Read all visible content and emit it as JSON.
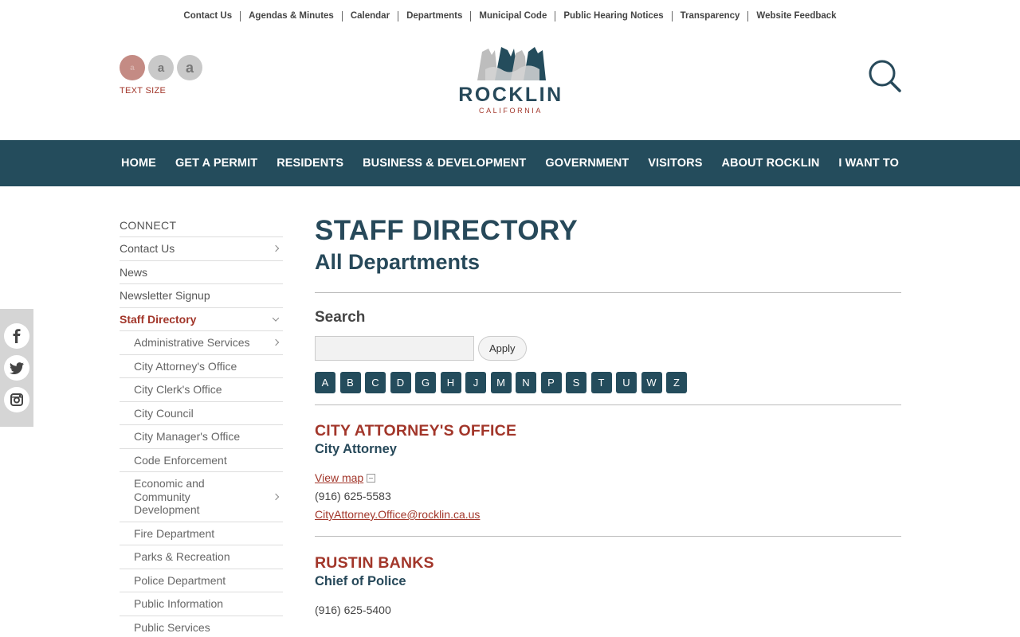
{
  "utility": {
    "links": [
      "Contact Us",
      "Agendas & Minutes",
      "Calendar",
      "Departments",
      "Municipal Code",
      "Public Hearing Notices",
      "Transparency",
      "Website Feedback"
    ]
  },
  "header": {
    "text_size": {
      "small": "a",
      "medium": "a",
      "large": "a",
      "label": "TEXT SIZE"
    },
    "logo": {
      "name": "ROCKLIN",
      "sub": "CALIFORNIA"
    },
    "search_icon": "search-icon"
  },
  "nav": [
    "HOME",
    "GET A PERMIT",
    "RESIDENTS",
    "BUSINESS & DEVELOPMENT",
    "GOVERNMENT",
    "VISITORS",
    "ABOUT ROCKLIN",
    "I WANT TO"
  ],
  "sidebar": {
    "heading": "CONNECT",
    "items": [
      {
        "label": "Contact Us"
      },
      {
        "label": "News"
      },
      {
        "label": "Newsletter Signup"
      },
      {
        "label": "Staff Directory"
      }
    ],
    "subitems": [
      {
        "label": "Administrative Services"
      },
      {
        "label": "City Attorney's Office"
      },
      {
        "label": "City Clerk's Office"
      },
      {
        "label": "City Council"
      },
      {
        "label": "City Manager's Office"
      },
      {
        "label": "Code Enforcement"
      },
      {
        "label": "Economic and Community Development"
      },
      {
        "label": "Fire Department"
      },
      {
        "label": "Parks & Recreation"
      },
      {
        "label": "Police Department"
      },
      {
        "label": "Public Information"
      },
      {
        "label": "Public Services"
      }
    ]
  },
  "social": [
    "facebook-icon",
    "twitter-icon",
    "instagram-icon"
  ],
  "main": {
    "title": "STAFF DIRECTORY",
    "subtitle": "All Departments",
    "search": {
      "heading": "Search",
      "value": "",
      "placeholder": "",
      "apply_label": "Apply"
    },
    "letters": [
      "A",
      "B",
      "C",
      "D",
      "G",
      "H",
      "J",
      "M",
      "N",
      "P",
      "S",
      "T",
      "U",
      "W",
      "Z"
    ],
    "entries": [
      {
        "name": "CITY ATTORNEY'S OFFICE",
        "title": "City Attorney",
        "map_label": "View map",
        "phone": "(916) 625-5583",
        "email": "CityAttorney.Office@rocklin.ca.us"
      },
      {
        "name": "RUSTIN BANKS",
        "title": "Chief of Police",
        "phone": "(916) 625-5400"
      }
    ]
  },
  "colors": {
    "brand_teal": "#244c5c",
    "accent_red": "#a2362a"
  }
}
